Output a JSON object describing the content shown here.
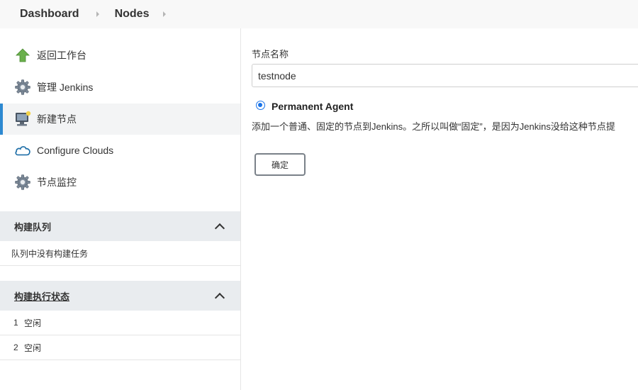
{
  "breadcrumb": {
    "items": [
      "Dashboard",
      "Nodes"
    ]
  },
  "sidebar": {
    "tasks": [
      {
        "label": "返回工作台",
        "icon": "up-arrow-icon"
      },
      {
        "label": "管理 Jenkins",
        "icon": "gear-icon"
      },
      {
        "label": "新建节点",
        "icon": "computer-new-icon"
      },
      {
        "label": "Configure Clouds",
        "icon": "cloud-icon"
      },
      {
        "label": "节点监控",
        "icon": "gear-icon"
      }
    ],
    "build_queue": {
      "title": "构建队列",
      "empty_text": "队列中没有构建任务"
    },
    "executor_status": {
      "title": "构建执行状态",
      "executors": [
        {
          "number": "1",
          "status": "空闲"
        },
        {
          "number": "2",
          "status": "空闲"
        }
      ]
    }
  },
  "form": {
    "name_label": "节点名称",
    "name_value": "testnode",
    "agent_type_label": "Permanent Agent",
    "agent_type_description": "添加一个普通、固定的节点到Jenkins。之所以叫做“固定”，是因为Jenkins没给这种节点提",
    "ok_label": "确定"
  },
  "colors": {
    "accent": "#2d89d1",
    "radio": "#1a73e8",
    "arrow": "#6ab04c",
    "cloud": "#1f6fa8"
  }
}
